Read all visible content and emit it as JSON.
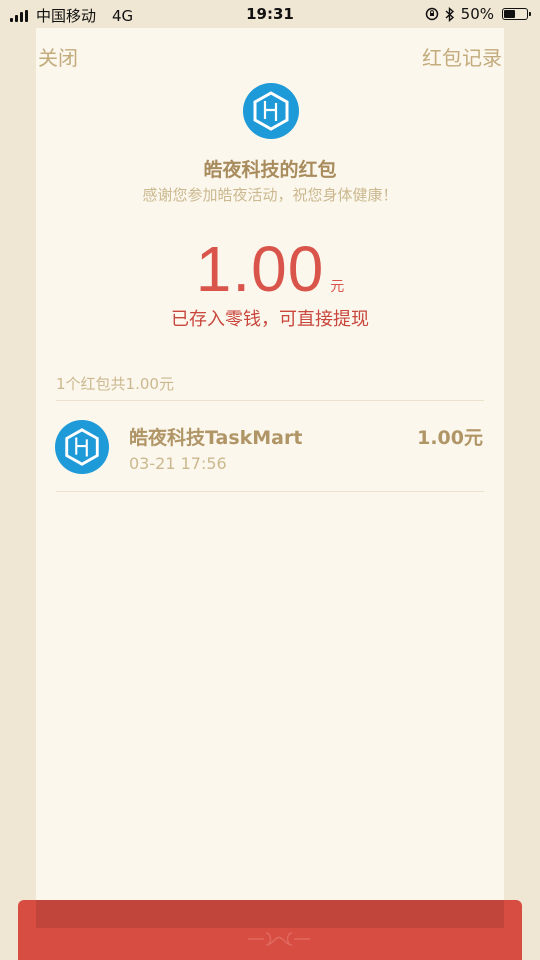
{
  "status": {
    "carrier": "中国移动",
    "network": "4G",
    "time": "19:31",
    "battery_percent": "50%",
    "battery_level": 0.5
  },
  "nav": {
    "close_label": "关闭",
    "records_label": "红包记录"
  },
  "sender": {
    "title": "皓夜科技的红包",
    "blessing": "感谢您参加皓夜活动，祝您身体健康！"
  },
  "amount": {
    "value": "1.00",
    "unit": "元",
    "note": "已存入零钱，可直接提现"
  },
  "summary": "1个红包共1.00元",
  "records": [
    {
      "name": "皓夜科技TaskMart",
      "time": "03-21 17:56",
      "amount": "1.00元"
    }
  ],
  "colors": {
    "accent_red": "#d9544a",
    "gold_text": "#b09566",
    "logo_blue": "#1e9ad9"
  }
}
